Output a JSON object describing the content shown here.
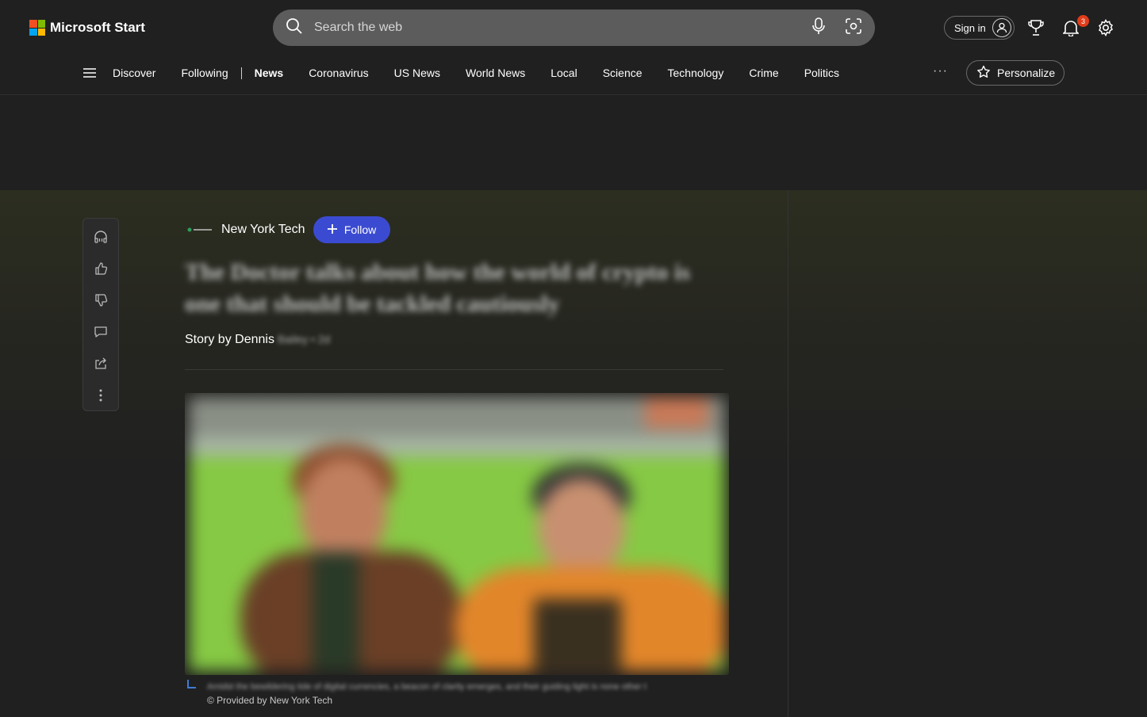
{
  "header": {
    "logo_text": "Microsoft Start",
    "search_placeholder": "Search the web",
    "signin_label": "Sign in",
    "notification_count": "3"
  },
  "nav": {
    "items": [
      "Discover",
      "Following",
      "News",
      "Coronavirus",
      "US News",
      "World News",
      "Local",
      "Science",
      "Technology",
      "Crime",
      "Politics"
    ],
    "active": "News",
    "more_label": "···",
    "personalize_label": "Personalize"
  },
  "article": {
    "publisher": "New York Tech",
    "follow_label": "Follow",
    "headline": "The Doctor talks about how the world of crypto is one that should be tackled cautiously",
    "byline_prefix": "Story by Dennis",
    "byline_rest": "Bailey • 2d",
    "caption": "Amidst the bewildering tide of digital currencies, a beacon of clarity emerges, and their guiding light is none other t",
    "credit": "© Provided by New York Tech"
  },
  "side_rail": {
    "icons": [
      "headphones-icon",
      "like-icon",
      "dislike-icon",
      "comment-icon",
      "share-icon",
      "more-icon"
    ]
  },
  "colors": {
    "background": "#202020",
    "search_bg": "#5c5c5c",
    "follow_button": "#3b4bd1",
    "badge": "#e03c1b"
  }
}
